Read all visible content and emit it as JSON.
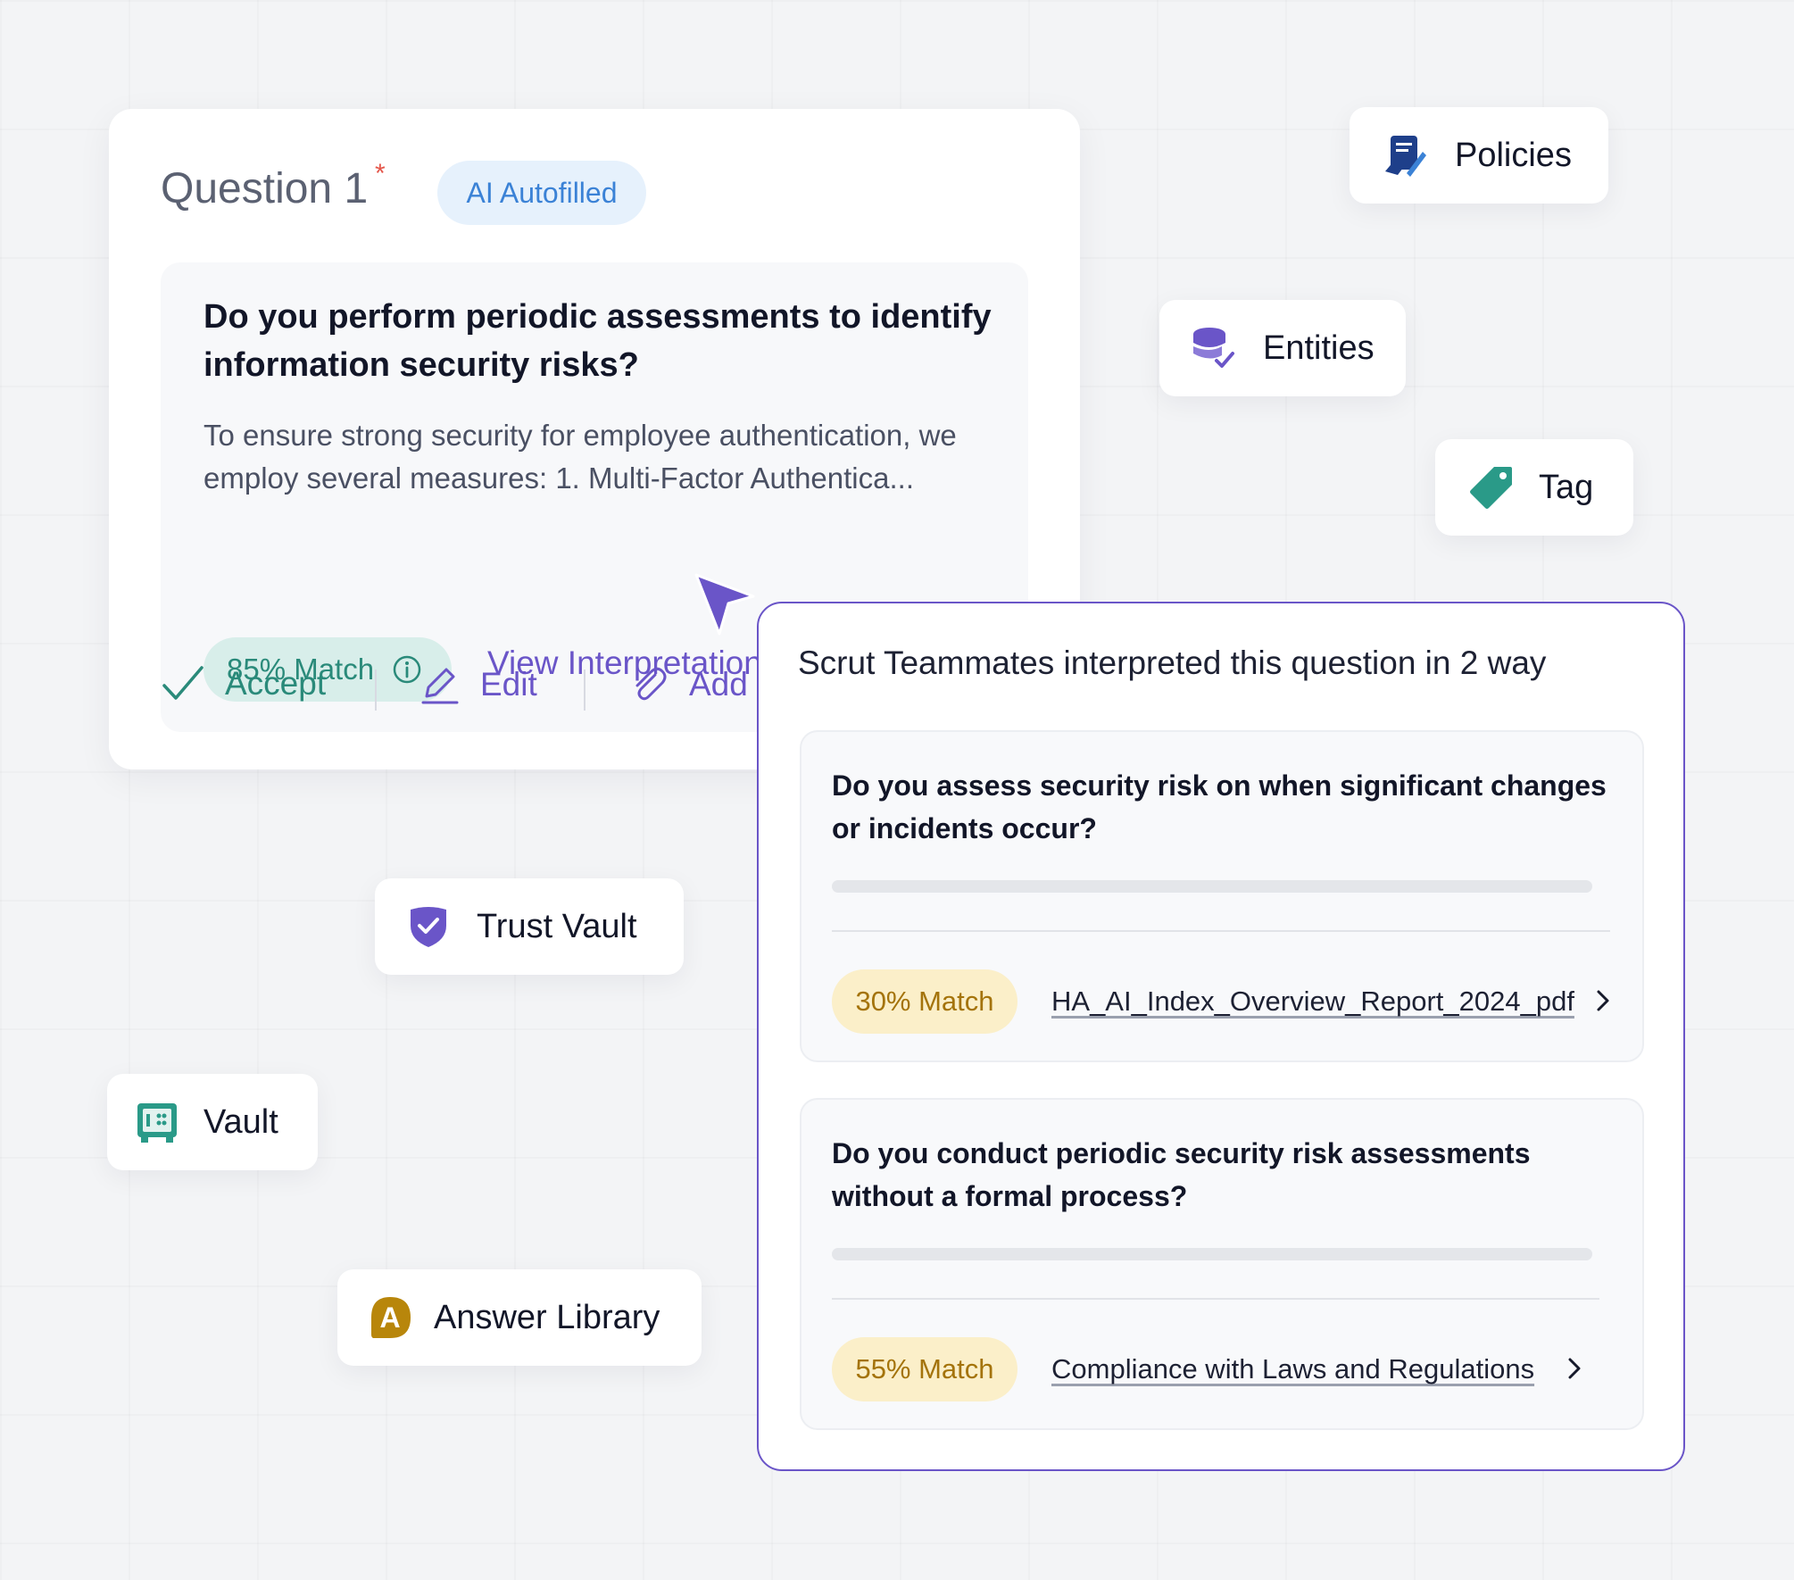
{
  "question_card": {
    "title": "Question 1",
    "required_mark": "*",
    "badge": "AI Autofilled",
    "question": "Do you perform periodic assessments to identify information security risks?",
    "answer_preview": "To ensure strong security for employee authentication, we employ several measures: 1. Multi-Factor Authentica...",
    "match": "85% Match",
    "view_interpretations": "View Interpretations",
    "actions": {
      "accept": "Accept",
      "edit": "Edit",
      "add": "Add"
    }
  },
  "floating_tags": {
    "policies": "Policies",
    "entities": "Entities",
    "tag": "Tag",
    "trust_vault": "Trust Vault",
    "vault": "Vault",
    "answer_library": "Answer Library",
    "answer_library_letter": "A"
  },
  "interpretations": {
    "title": "Scrut Teammates interpreted this question in 2 way",
    "items": [
      {
        "question": "Do you  assess security risk on when significant changes or incidents occur?",
        "match": "30% Match",
        "source": "HA_AI_Index_Overview_Report_2024_pdf"
      },
      {
        "question": "Do you conduct periodic security risk assessments without a formal process?",
        "match": "55% Match",
        "source": "Compliance with Laws and Regulations"
      }
    ]
  },
  "colors": {
    "accent_purple": "#6a55c8",
    "teal": "#2a8a7a",
    "blue_badge": "#3b82d6",
    "amber": "#a4730a"
  },
  "icons": [
    "policies-icon",
    "entities-icon",
    "tag-icon",
    "trust-vault-icon",
    "vault-icon",
    "answer-library-icon",
    "info-icon",
    "check-icon",
    "pencil-icon",
    "paperclip-icon",
    "chevron-right-icon",
    "cursor-icon"
  ]
}
